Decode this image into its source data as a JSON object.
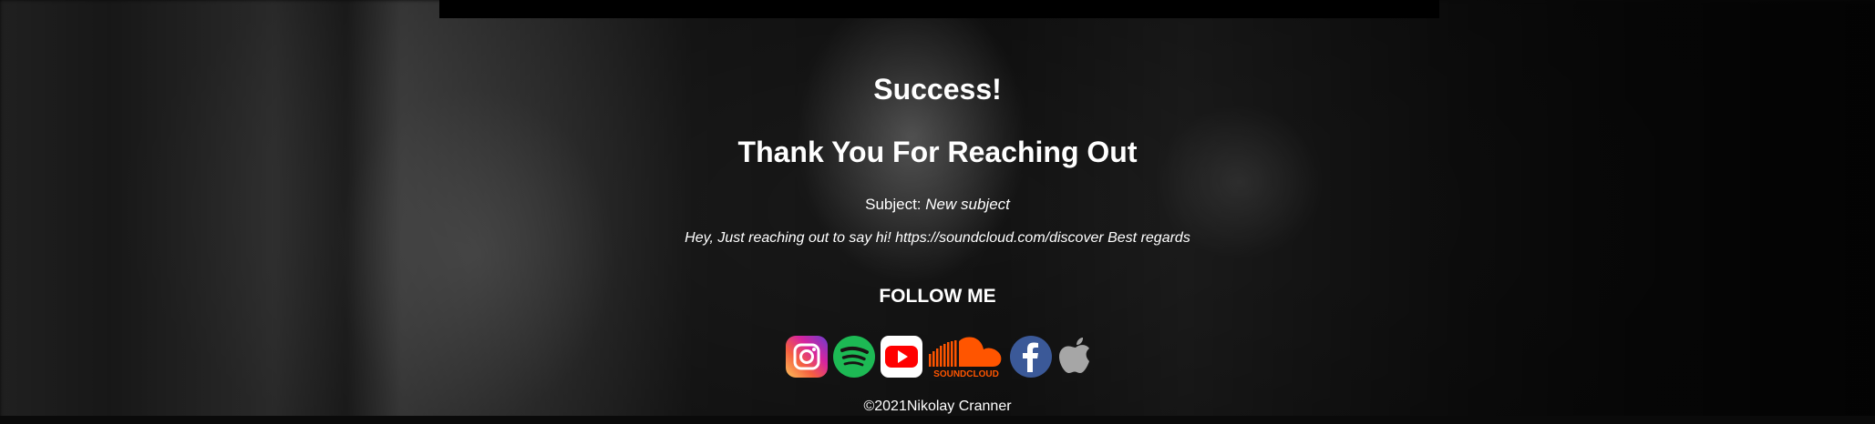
{
  "page": {
    "title": "Success!",
    "subtitle": "Thank You For Reaching Out",
    "subject_label": "Subject:",
    "subject_value": "New subject",
    "message": "Hey, Just reaching out to say hi! https://soundcloud.com/discover Best regards",
    "follow_heading": "FOLLOW ME",
    "footer": "©2021Nikolay Cranner"
  },
  "socials": [
    {
      "icon": "instagram-icon",
      "color": "#d6249f"
    },
    {
      "icon": "spotify-icon",
      "color": "#1db954"
    },
    {
      "icon": "youtube-icon",
      "color": "#ff0000"
    },
    {
      "icon": "soundcloud-icon",
      "color": "#ff5500",
      "label": "SOUNDCLOUD"
    },
    {
      "icon": "facebook-icon",
      "color": "#3b5998"
    },
    {
      "icon": "apple-icon",
      "color": "#a6a6a6"
    }
  ]
}
